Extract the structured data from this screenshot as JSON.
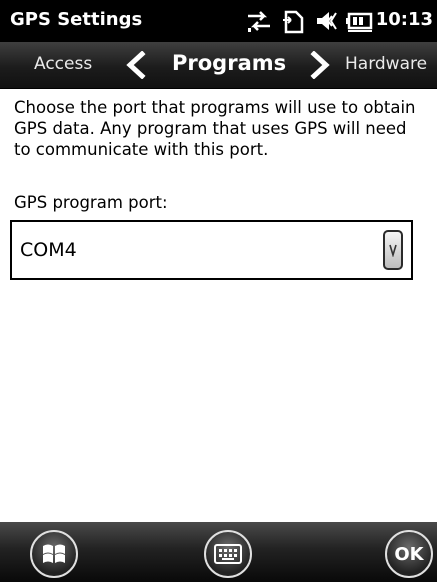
{
  "titlebar": {
    "title": "GPS Settings",
    "time": "10:13",
    "icons": [
      "data-connection-icon",
      "sim-icon",
      "volume-icon",
      "battery-icon"
    ]
  },
  "tabs": {
    "previous": "Access",
    "current": "Programs",
    "next": "Hardware"
  },
  "content": {
    "description": "Choose the port that programs will use to obtain GPS data. Any program that uses GPS will need to communicate with this port.",
    "port_label": "GPS program port:",
    "port_value": "COM4"
  },
  "softkeys": {
    "start_icon": "windows-start-icon",
    "keyboard_icon": "keyboard-icon",
    "ok_label": "OK"
  }
}
